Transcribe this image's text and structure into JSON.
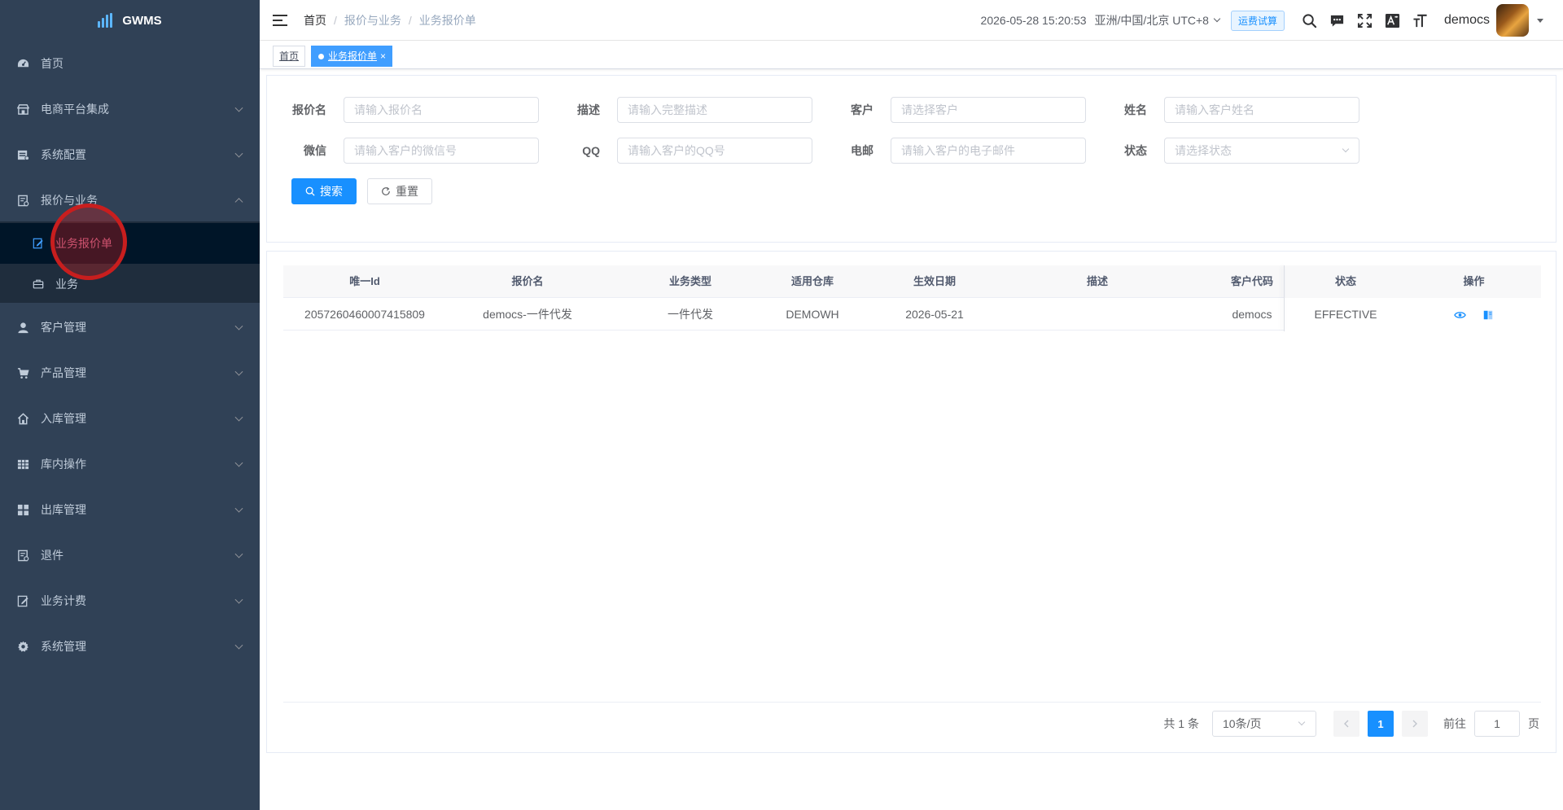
{
  "app": {
    "name": "GWMS"
  },
  "sidebar": {
    "items": [
      {
        "label": "首页"
      },
      {
        "label": "电商平台集成"
      },
      {
        "label": "系统配置"
      },
      {
        "label": "报价与业务"
      },
      {
        "label": "客户管理"
      },
      {
        "label": "产品管理"
      },
      {
        "label": "入库管理"
      },
      {
        "label": "库内操作"
      },
      {
        "label": "出库管理"
      },
      {
        "label": "退件"
      },
      {
        "label": "业务计费"
      },
      {
        "label": "系统管理"
      }
    ],
    "subitems": [
      {
        "label": "业务报价单",
        "active": true
      },
      {
        "label": "业务"
      }
    ]
  },
  "header": {
    "breadcrumb": [
      "首页",
      "报价与业务",
      "业务报价单"
    ],
    "separator": "/",
    "datetime": "2026-05-28 15:20:53",
    "timezone": "亚洲/中国/北京 UTC+8",
    "freight_button": "运费试算",
    "username": "democs"
  },
  "tags": {
    "home": "首页",
    "active": "业务报价单",
    "close": "×"
  },
  "search": {
    "fields": {
      "quote_name": {
        "label": "报价名",
        "placeholder": "请输入报价名",
        "value": ""
      },
      "description": {
        "label": "描述",
        "placeholder": "请输入完整描述",
        "value": ""
      },
      "customer": {
        "label": "客户",
        "placeholder": "请选择客户",
        "value": ""
      },
      "surname": {
        "label": "姓名",
        "placeholder": "请输入客户姓名",
        "value": ""
      },
      "wechat": {
        "label": "微信",
        "placeholder": "请输入客户的微信号",
        "value": ""
      },
      "qq": {
        "label": "QQ",
        "placeholder": "请输入客户的QQ号",
        "value": ""
      },
      "email": {
        "label": "电邮",
        "placeholder": "请输入客户的电子邮件",
        "value": ""
      },
      "status": {
        "label": "状态",
        "placeholder": "请选择状态",
        "value": ""
      }
    },
    "search_button": "搜索",
    "reset_button": "重置"
  },
  "table": {
    "columns": [
      "唯一Id",
      "报价名",
      "业务类型",
      "适用仓库",
      "生效日期",
      "描述",
      "客户代码",
      "状态",
      "操作"
    ],
    "rows": [
      {
        "id": "2057260460007415809",
        "name": "democs-一件代发",
        "business_type": "一件代发",
        "warehouse": "DEMOWH",
        "effective_date": "2026-05-21",
        "description": "",
        "customer_code": "democs",
        "status": "EFFECTIVE"
      }
    ]
  },
  "pagination": {
    "total": "共 1 条",
    "page_size": "10条/页",
    "current_page": "1",
    "goto_label": "前往",
    "goto_value": "1",
    "page_suffix": "页"
  },
  "colors": {
    "sidebar_bg": "#304156",
    "sidebar_active_text": "#cf6f9a",
    "primary": "#1890ff"
  }
}
